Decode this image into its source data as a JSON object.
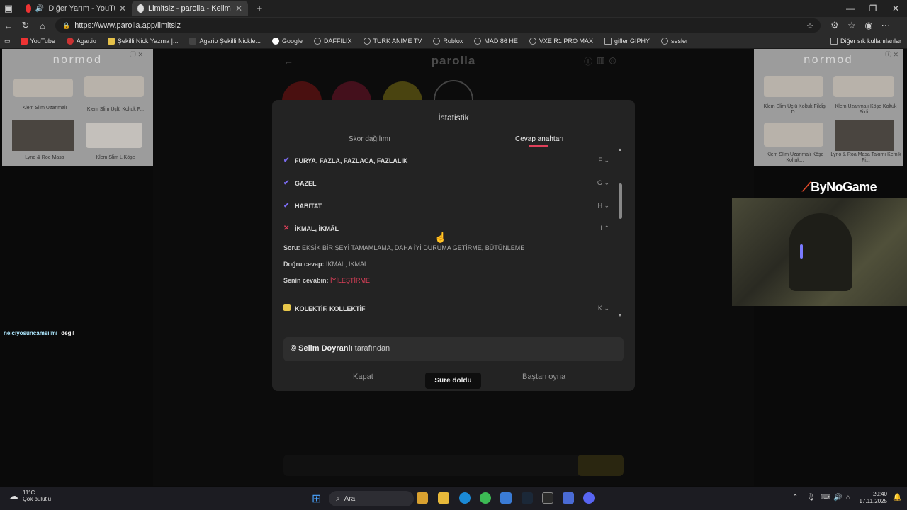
{
  "tabs": [
    {
      "title": "Diğer Yarım - YouTube Music"
    },
    {
      "title": "Limitsiz - parolla - Kelime oyunu"
    }
  ],
  "address": {
    "url": "https://www.parolla.app/limitsiz"
  },
  "bookmarks": [
    "YouTube",
    "Agar.io",
    "Şekilli Nick Yazma |...",
    "Agario Şekilli Nickle...",
    "Google",
    "DAFFİLİX",
    "TÜRK ANİME TV",
    "Roblox",
    "MAD 86 HE",
    "VXE R1 PRO MAX",
    "gifler GIPHY",
    "sesler"
  ],
  "bookmarks_other": "Diğer sık kullanılanlar",
  "ad_left": {
    "brand": "normod",
    "items": [
      "Klem Slim Uzanmalı",
      "Klem Slim Üçlü Koltuk F...",
      "Lyno & Roe Masa",
      "Klem Slim L Köşe"
    ]
  },
  "ad_right": {
    "brand": "normod",
    "items": [
      "Klem Slim Üçlü Koltuk Fildişi D...",
      "Klem Uzanmalı Köşe Koltuk Fildi...",
      "Klem Slim Uzanmalı Köşe Koltuk...",
      "Lyno & Roa Masa Takımı Kemik Fi..."
    ]
  },
  "game": {
    "title": "parolla"
  },
  "modal": {
    "title": "İstatistik",
    "tab_scores": "Skor dağılımı",
    "tab_answers": "Cevap anahtarı",
    "rows": [
      {
        "answer": "FURYA, FAZLA, FAZLACA, FAZLALIK",
        "letter": "F",
        "status": "correct"
      },
      {
        "answer": "GAZEL",
        "letter": "G",
        "status": "correct"
      },
      {
        "answer": "HABİTAT",
        "letter": "H",
        "status": "correct"
      },
      {
        "answer": "İKMAL, İKMÂL",
        "letter": "İ",
        "status": "wrong"
      },
      {
        "answer": "KOLEKTİF, KOLLEKTİF",
        "letter": "K",
        "status": "passed"
      }
    ],
    "detail": {
      "question_label": "Soru:",
      "question": "EKSİK BİR ŞEYİ TAMAMLAMA, DAHA İYİ DURUMA GETİRME, BÜTÜNLEME",
      "correct_label": "Doğru cevap:",
      "correct": "İKMAL, İKMÂL",
      "yours_label": "Senin cevabın:",
      "yours": "İYİLEŞTİRME"
    },
    "credit_name": "© Selim Doyranlı",
    "credit_suffix": "tarafından",
    "btn_close": "Kapat",
    "btn_timeout": "Süre doldu",
    "btn_restart": "Baştan oyna"
  },
  "stream": {
    "chat_user": "neiciyosuncamsilmi",
    "chat_msg": "değil",
    "sponsor": "ByNoGame"
  },
  "taskbar": {
    "temp": "11°C",
    "weather": "Çok bulutlu",
    "search": "Ara",
    "time": "20:40",
    "date": "17.11.2025"
  },
  "colors": {
    "accent": "#e0405a",
    "check": "#7b6cf0",
    "cross": "#e0405a",
    "pass": "#e7c64a"
  }
}
